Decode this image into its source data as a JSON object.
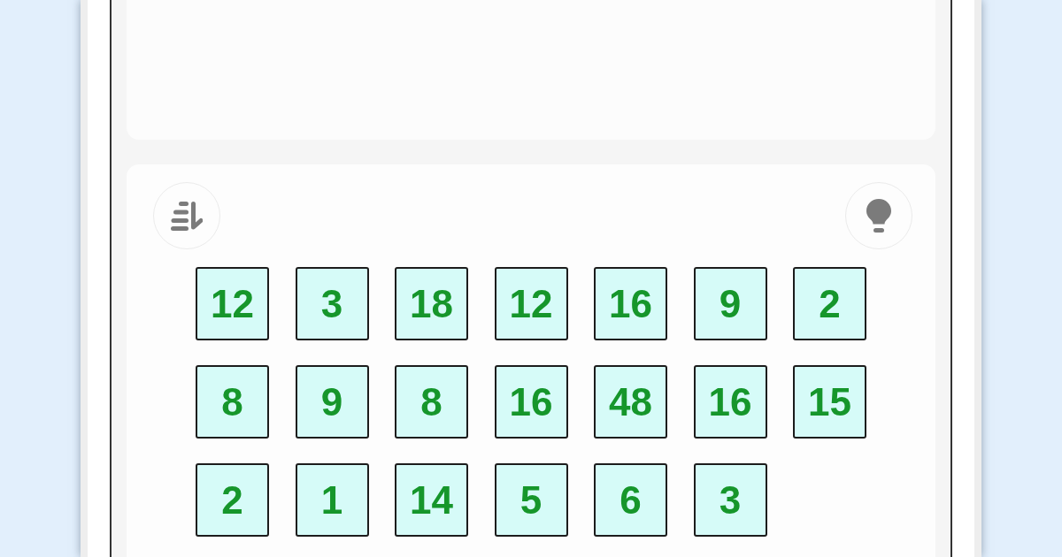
{
  "tile_rows": [
    [
      "12",
      "3",
      "18",
      "12",
      "16",
      "9",
      "2"
    ],
    [
      "8",
      "9",
      "8",
      "16",
      "48",
      "16",
      "15"
    ],
    [
      "2",
      "1",
      "14",
      "5",
      "6",
      "3"
    ]
  ]
}
